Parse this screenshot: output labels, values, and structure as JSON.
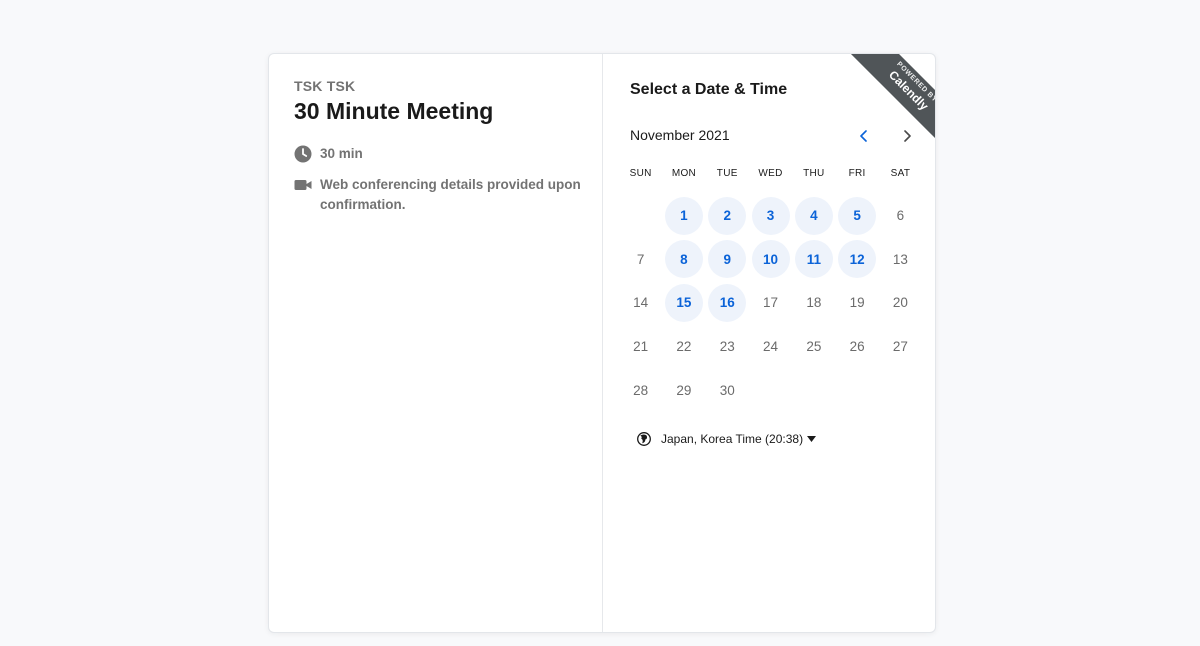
{
  "event": {
    "host": "TSK TSK",
    "title": "30 Minute Meeting",
    "duration": "30 min",
    "conferencing": "Web conferencing details provided upon confirmation."
  },
  "scheduler": {
    "title": "Select a Date & Time",
    "month_label": "November 2021",
    "weekdays": [
      "SUN",
      "MON",
      "TUE",
      "WED",
      "THU",
      "FRI",
      "SAT"
    ],
    "first_weekday_offset": 1,
    "days": [
      {
        "n": "1",
        "available": true
      },
      {
        "n": "2",
        "available": true
      },
      {
        "n": "3",
        "available": true
      },
      {
        "n": "4",
        "available": true
      },
      {
        "n": "5",
        "available": true
      },
      {
        "n": "6",
        "available": false
      },
      {
        "n": "7",
        "available": false
      },
      {
        "n": "8",
        "available": true
      },
      {
        "n": "9",
        "available": true
      },
      {
        "n": "10",
        "available": true
      },
      {
        "n": "11",
        "available": true
      },
      {
        "n": "12",
        "available": true
      },
      {
        "n": "13",
        "available": false
      },
      {
        "n": "14",
        "available": false
      },
      {
        "n": "15",
        "available": true
      },
      {
        "n": "16",
        "available": true
      },
      {
        "n": "17",
        "available": false
      },
      {
        "n": "18",
        "available": false
      },
      {
        "n": "19",
        "available": false
      },
      {
        "n": "20",
        "available": false
      },
      {
        "n": "21",
        "available": false
      },
      {
        "n": "22",
        "available": false
      },
      {
        "n": "23",
        "available": false
      },
      {
        "n": "24",
        "available": false
      },
      {
        "n": "25",
        "available": false
      },
      {
        "n": "26",
        "available": false
      },
      {
        "n": "27",
        "available": false
      },
      {
        "n": "28",
        "available": false
      },
      {
        "n": "29",
        "available": false
      },
      {
        "n": "30",
        "available": false
      }
    ],
    "timezone": "Japan, Korea Time (20:38)"
  },
  "ribbon": {
    "powered_by": "POWERED BY",
    "brand": "Calendly"
  },
  "icons": {
    "duration": "clock-icon",
    "conferencing": "video-camera-icon",
    "prev": "chevron-left-icon",
    "next": "chevron-right-icon",
    "timezone": "globe-icon",
    "dropdown": "caret-down-icon"
  },
  "colors": {
    "accent": "#0b63d8",
    "available_bg": "#eef3fb",
    "ribbon_bg": "#505558",
    "muted_text": "#737373"
  }
}
